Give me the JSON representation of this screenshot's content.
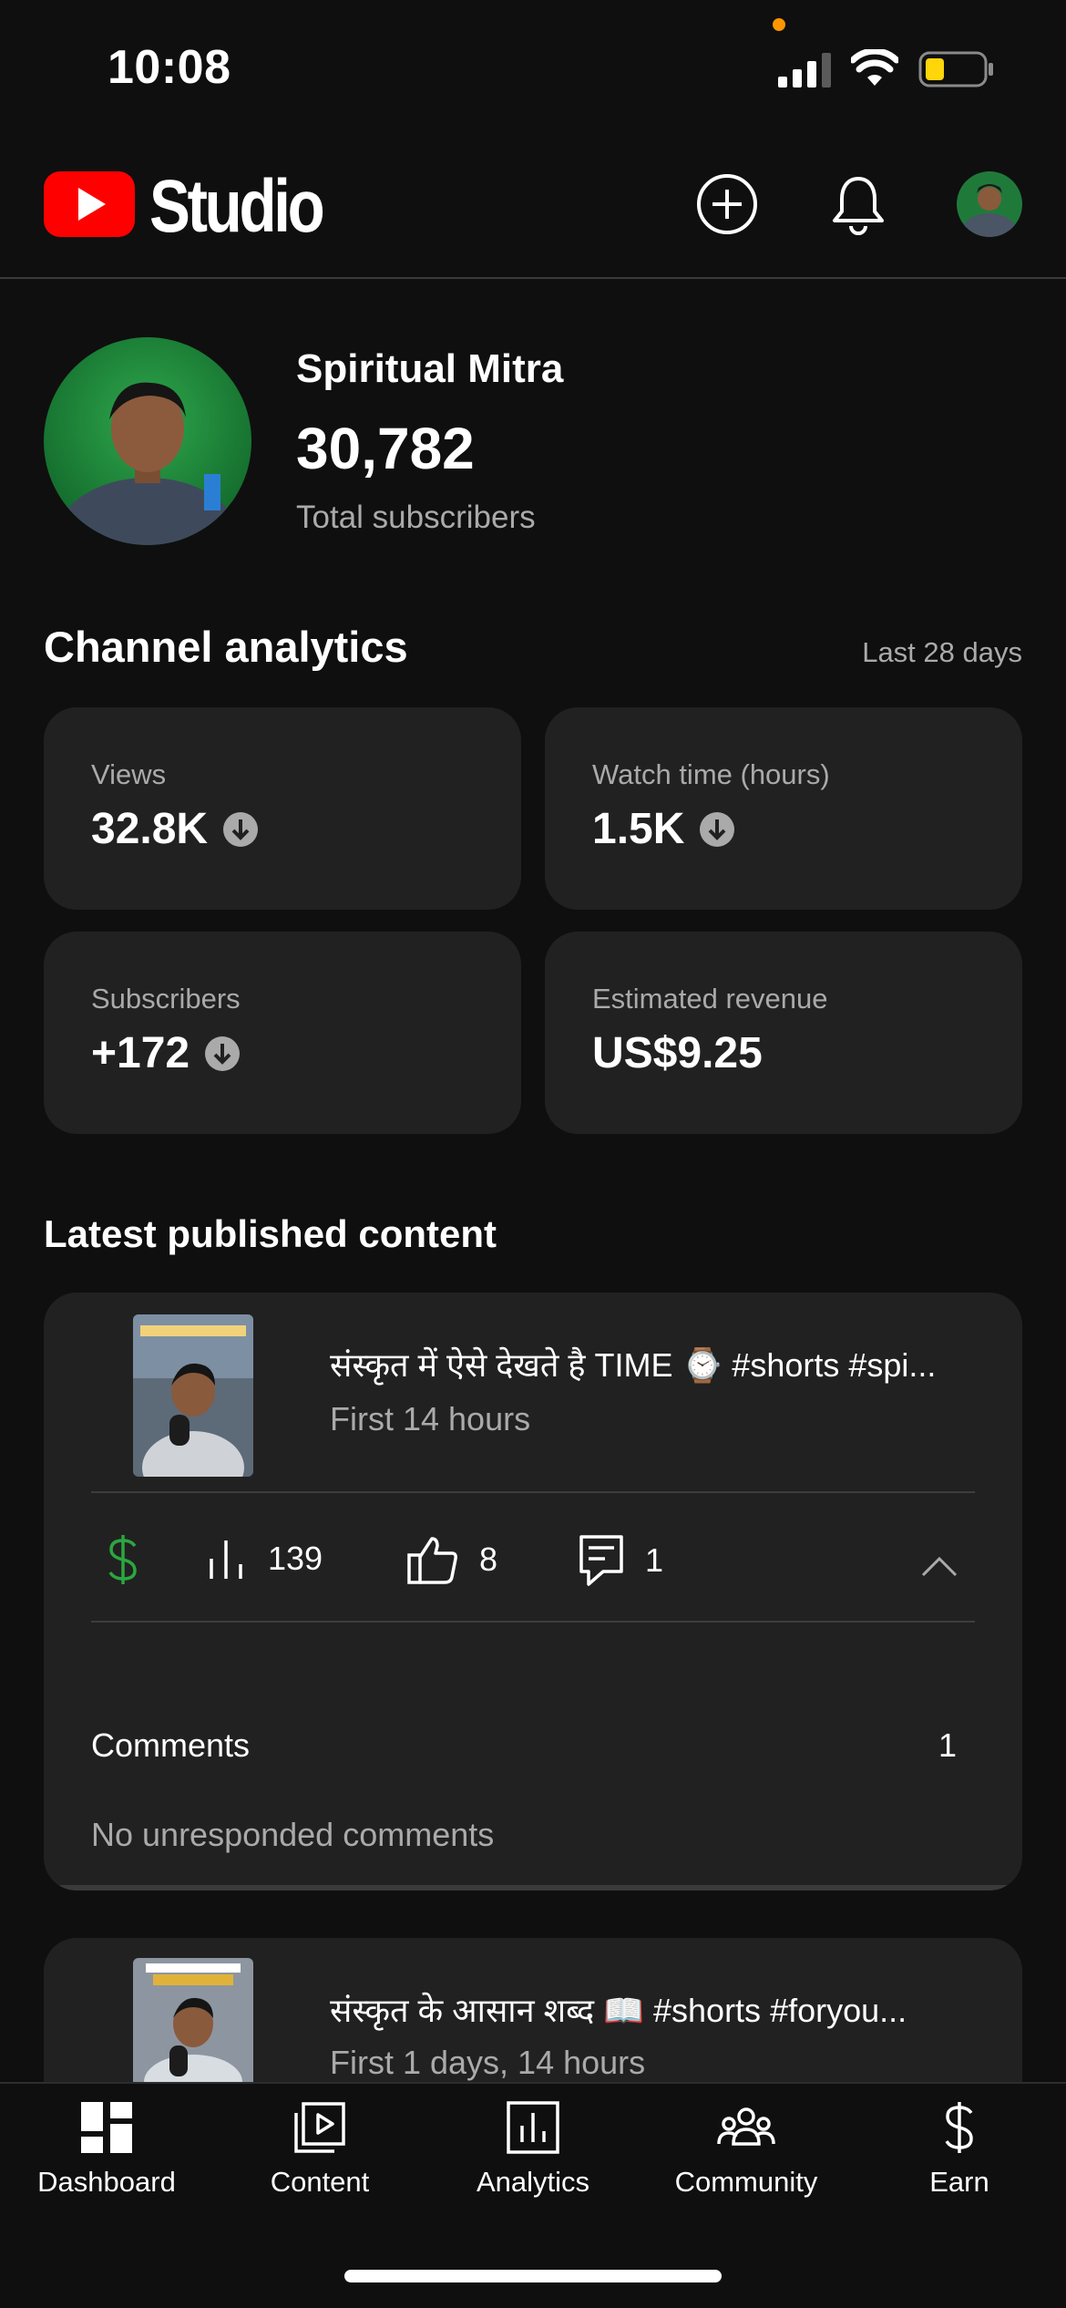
{
  "status_bar": {
    "time": "10:08"
  },
  "header": {
    "brand": "Studio"
  },
  "channel": {
    "name": "Spiritual Mitra",
    "subscriber_count": "30,782",
    "subscriber_label": "Total subscribers"
  },
  "analytics": {
    "title": "Channel analytics",
    "range": "Last 28 days",
    "cards": [
      {
        "label": "Views",
        "value": "32.8K",
        "trend": "down"
      },
      {
        "label": "Watch time (hours)",
        "value": "1.5K",
        "trend": "down"
      },
      {
        "label": "Subscribers",
        "value": "+172",
        "trend": "down"
      },
      {
        "label": "Estimated revenue",
        "value": "US$9.25",
        "trend": "none"
      }
    ]
  },
  "latest": {
    "title": "Latest published content",
    "items": [
      {
        "title": "संस्कृत में ऐसे देखते है TIME ⌚ #shorts #spi...",
        "subtitle": "First 14 hours",
        "views": "139",
        "likes": "8",
        "comments": "1",
        "comments_label": "Comments",
        "comments_count": "1",
        "comments_status": "No unresponded comments"
      },
      {
        "title": "संस्कृत के आसान शब्द 📖 #shorts #foryou...",
        "subtitle": "First 1 days, 14 hours"
      }
    ]
  },
  "nav": {
    "items": [
      {
        "label": "Dashboard",
        "icon": "dashboard-icon",
        "active": true
      },
      {
        "label": "Content",
        "icon": "content-icon"
      },
      {
        "label": "Analytics",
        "icon": "analytics-icon"
      },
      {
        "label": "Community",
        "icon": "community-icon"
      },
      {
        "label": "Earn",
        "icon": "earn-icon"
      }
    ]
  },
  "colors": {
    "background": "#0f0f0f",
    "card": "#212121",
    "brand_red": "#ff0000",
    "revenue_green": "#2ba640",
    "secondary_text": "#aaaaaa"
  }
}
